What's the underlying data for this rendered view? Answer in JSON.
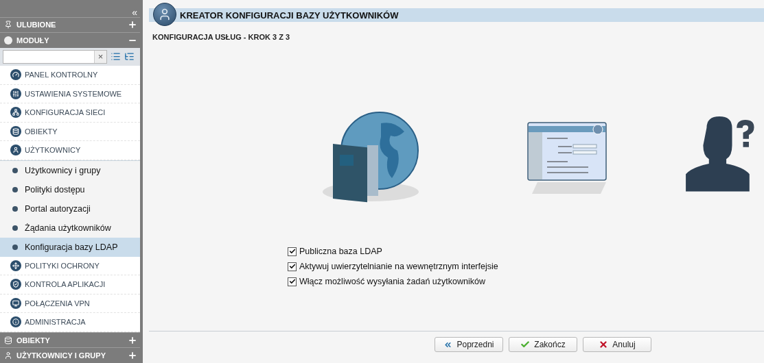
{
  "sidebar": {
    "collapse": "«",
    "top_sections": [
      {
        "label": "ULUBIONE",
        "expanded": false
      },
      {
        "label": "MODUŁY",
        "expanded": true
      }
    ],
    "search": {
      "clear": "×"
    },
    "modules": [
      {
        "label": "PANEL KONTROLNY"
      },
      {
        "label": "USTAWIENIA SYSTEMOWE"
      },
      {
        "label": "KONFIGURACJA SIECI"
      },
      {
        "label": "OBIEKTY"
      },
      {
        "label": "UŻYTKOWNICY",
        "children": [
          {
            "label": "Użytkownicy i grupy",
            "selected": false
          },
          {
            "label": "Polityki dostępu",
            "selected": false
          },
          {
            "label": "Portal autoryzacji",
            "selected": false
          },
          {
            "label": "Żądania użytkowników",
            "selected": false
          },
          {
            "label": "Konfiguracja bazy LDAP",
            "selected": true
          }
        ]
      },
      {
        "label": "POLITYKI OCHRONY"
      },
      {
        "label": "KONTROLA APLIKACJI"
      },
      {
        "label": "POŁĄCZENIA VPN"
      },
      {
        "label": "ADMINISTRACJA"
      }
    ],
    "bottom_sections": [
      {
        "label": "OBIEKTY",
        "expanded": false
      },
      {
        "label": "UŻYTKOWNICY I GRUPY",
        "expanded": false
      }
    ]
  },
  "wizard": {
    "title": "KREATOR KONFIGURACJI BAZY UŻYTKOWNIKÓW",
    "step": "KONFIGURACJA USŁUG - KROK 3 Z 3",
    "options": [
      {
        "label": "Publiczna baza LDAP",
        "checked": true
      },
      {
        "label": "Aktywuj uwierzytelnianie na wewnętrznym interfejsie",
        "checked": true
      },
      {
        "label": "Włącz możliwość wysyłania żadań użytkowników",
        "checked": true
      }
    ],
    "buttons": [
      {
        "kind": "back",
        "label": "Poprzedni"
      },
      {
        "kind": "finish",
        "label": "Zakończ"
      },
      {
        "kind": "cancel",
        "label": "Anuluj"
      }
    ]
  }
}
